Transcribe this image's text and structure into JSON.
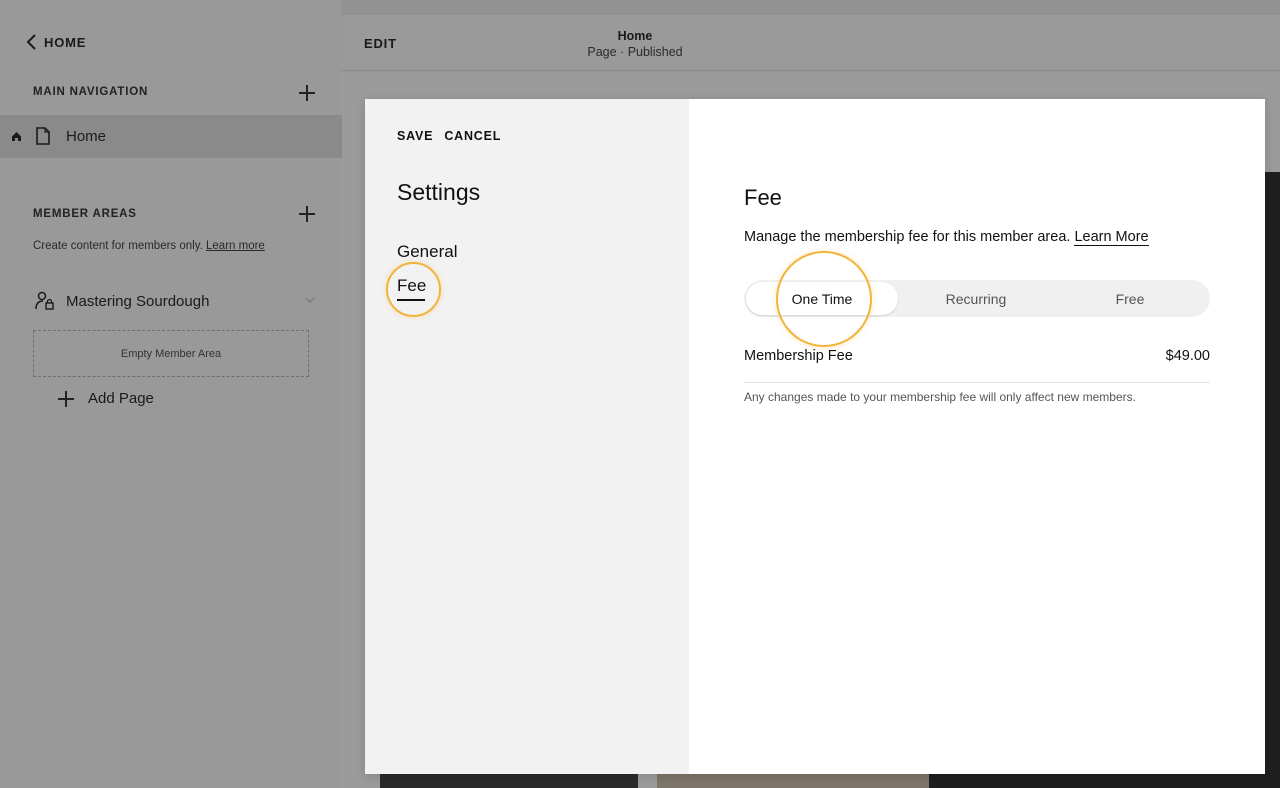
{
  "sidebar": {
    "back_label": "HOME",
    "main_navigation_heading": "MAIN NAVIGATION",
    "nav_items": [
      {
        "label": "Home"
      }
    ],
    "member_areas_heading": "MEMBER AREAS",
    "member_desc": "Create content for members only.",
    "member_learn_more": "Learn more",
    "member_area": {
      "label": "Mastering Sourdough",
      "empty_label": "Empty Member Area"
    },
    "add_page_label": "Add Page"
  },
  "topbar": {
    "edit_label": "EDIT",
    "page_title": "Home",
    "page_status": "Page · Published"
  },
  "modal": {
    "save_label": "SAVE",
    "cancel_label": "CANCEL",
    "settings_title": "Settings",
    "menu": {
      "general": "General",
      "fee": "Fee"
    },
    "fee": {
      "title": "Fee",
      "description": "Manage the membership fee for this member area.",
      "learn_more": "Learn More",
      "options": [
        "One Time",
        "Recurring",
        "Free"
      ],
      "selected_option": "One Time",
      "membership_fee_label": "Membership Fee",
      "membership_fee_value": "$49.00",
      "note": "Any changes made to your membership fee will only affect new members."
    }
  },
  "colors": {
    "highlight_ring": "#f2b43c",
    "overlay_gray": "#999999",
    "modal_left_bg": "#f2f2f2"
  }
}
